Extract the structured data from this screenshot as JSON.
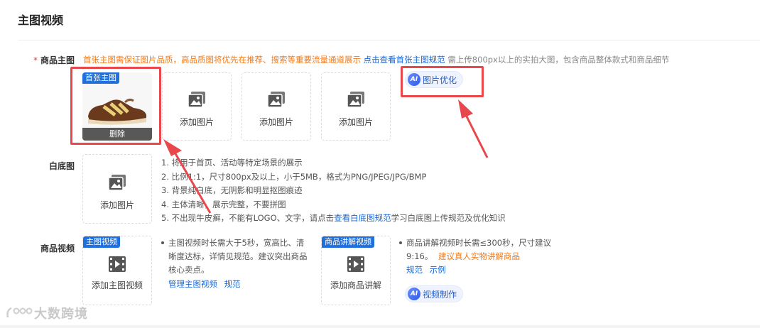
{
  "section_title": "主图视频",
  "main_image": {
    "label": "商品主图",
    "required_mark": "*",
    "hint_orange": "首张主图需保证图片品质，高品质图将优先在推荐、搜索等重要流量通道展示",
    "hint_link": "点击查看首张主图规范",
    "hint_gray": "需上传800px以上的实拍大图，包含商品整体款式和商品细节",
    "first_badge": "首张主图",
    "delete_label": "删除",
    "add_label": "添加图片",
    "ai_optimize": "图片优化"
  },
  "white_bg": {
    "label": "白底图",
    "add_label": "添加图片",
    "rules": [
      "1. 将用于首页、活动等特定场景的展示",
      "2. 比例1:1，尺寸800px及以上，小于5MB，格式为PNG/JPEG/JPG/BMP",
      "3. 背景纯白底，无阴影和明显抠图痕迹",
      "4. 主体清晰，展示完整，不要拼图"
    ],
    "rule5_prefix": "5. 不出现牛皮癣，不能有LOGO、文字，请点击",
    "rule5_link": "查看白底图规范",
    "rule5_suffix": "学习白底图上传规范及优化知识"
  },
  "video": {
    "label": "商品视频",
    "main_badge": "主图视频",
    "main_add": "添加主图视频",
    "main_desc_lines": [
      "主图视频时长需大于5秒，宽高比、清",
      "晰度达标，详情见规范。建议突出商品",
      "核心卖点。"
    ],
    "main_links": [
      "管理主图视频",
      "规范"
    ],
    "explain_badge": "商品讲解视频",
    "explain_add": "添加商品讲解",
    "explain_desc_line1": "商品讲解视频时长需≤300秒，尺寸建议",
    "explain_desc_line2a": "9:16。",
    "explain_desc_line2b": "建议真人实物讲解商品",
    "explain_links": [
      "规范",
      "示例"
    ],
    "ai_video": "视频制作"
  },
  "ai_badge": "AI",
  "watermark": "大数跨境",
  "colors": {
    "highlight": "#e8474c",
    "link": "#1966d6",
    "orange": "#f07a1b",
    "badge": "#1f6fdc"
  }
}
